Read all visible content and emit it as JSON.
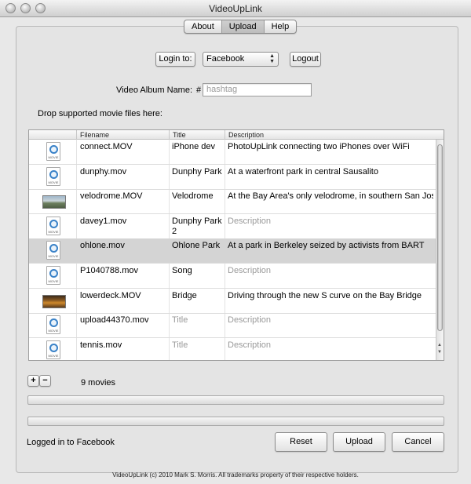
{
  "window": {
    "title": "VideoUpLink"
  },
  "tabs": [
    "About",
    "Upload",
    "Help"
  ],
  "active_tab": "Upload",
  "login": {
    "label": "Login to:",
    "service": "Facebook",
    "logout_label": "Logout"
  },
  "album": {
    "label": "Video Album Name:",
    "hash": "#",
    "placeholder": "hashtag"
  },
  "drop_label": "Drop supported movie files here:",
  "table": {
    "columns": [
      "Filename",
      "Title",
      "Description"
    ],
    "rows": [
      {
        "icon": "quicktime-movie-icon",
        "filename": "connect.MOV",
        "title": "iPhone dev",
        "title_placeholder": false,
        "description": "PhotoUpLink connecting two iPhones over WiFi",
        "description_placeholder": false
      },
      {
        "icon": "quicktime-movie-icon",
        "filename": "dunphy.mov",
        "title": "Dunphy Park",
        "title_placeholder": false,
        "description": "At a waterfront park in central Sausalito",
        "description_placeholder": false
      },
      {
        "icon": "video-thumbnail-velodrome",
        "filename": "velodrome.MOV",
        "title": "Velodrome",
        "title_placeholder": false,
        "description": "At the Bay Area's only velodrome, in southern San Jose",
        "description_placeholder": false
      },
      {
        "icon": "quicktime-movie-icon",
        "filename": "davey1.mov",
        "title": "Dunphy Park 2",
        "title_placeholder": false,
        "description": "Description",
        "description_placeholder": true
      },
      {
        "icon": "quicktime-movie-icon",
        "filename": "ohlone.mov",
        "title": "Ohlone Park",
        "title_placeholder": false,
        "description": "At a park in Berkeley seized by activists from BART",
        "description_placeholder": false
      },
      {
        "icon": "quicktime-movie-icon",
        "filename": "P1040788.mov",
        "title": "Song",
        "title_placeholder": false,
        "description": "Description",
        "description_placeholder": true
      },
      {
        "icon": "video-thumbnail-bridge",
        "filename": "lowerdeck.MOV",
        "title": "Bridge",
        "title_placeholder": false,
        "description": "Driving through the new S curve on the Bay Bridge",
        "description_placeholder": false
      },
      {
        "icon": "quicktime-movie-icon",
        "filename": "upload44370.mov",
        "title": "Title",
        "title_placeholder": true,
        "description": "Description",
        "description_placeholder": true
      },
      {
        "icon": "quicktime-movie-icon",
        "filename": "tennis.mov",
        "title": "Title",
        "title_placeholder": true,
        "description": "Description",
        "description_placeholder": true
      }
    ],
    "selected_filename": "ohlone.mov",
    "movie_icon_caption": "MOVIE"
  },
  "add_label": "+",
  "remove_label": "−",
  "movie_count": "9 movies",
  "status": "Logged in to Facebook",
  "buttons": {
    "reset": "Reset",
    "upload": "Upload",
    "cancel": "Cancel"
  },
  "footer": "VideoUpLink (c) 2010 Mark S. Morris. All trademarks property of their respective holders.",
  "colors": {
    "selected_row": "#d4d4d4",
    "quicktime_blue": "#3a82c8"
  }
}
